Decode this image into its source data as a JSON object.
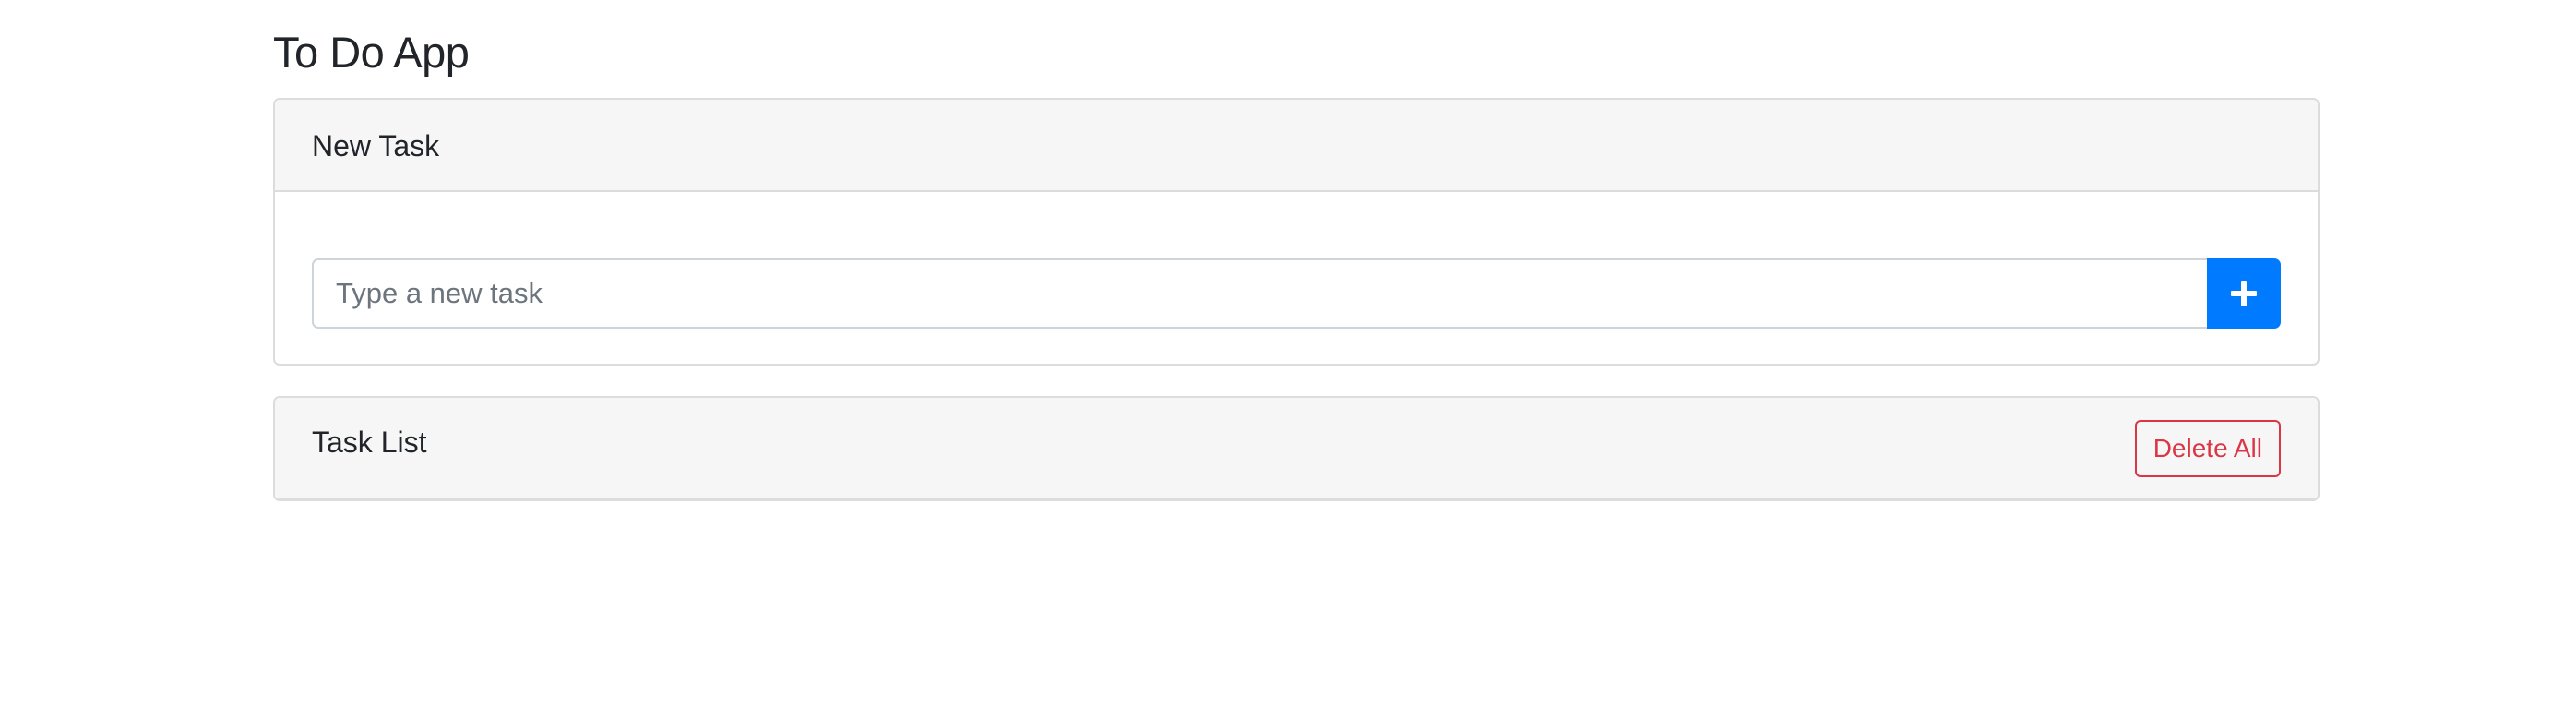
{
  "app": {
    "title": "To Do App"
  },
  "new_task_card": {
    "header": "New Task",
    "input": {
      "placeholder": "Type a new task",
      "value": ""
    },
    "add_button_icon": "plus-icon"
  },
  "task_list_card": {
    "header": "Task List",
    "delete_all_label": "Delete All",
    "tasks": []
  },
  "colors": {
    "primary": "#007bff",
    "danger": "#dc3545",
    "card_header_bg": "#f6f6f6",
    "border": "#dcdcdc"
  }
}
